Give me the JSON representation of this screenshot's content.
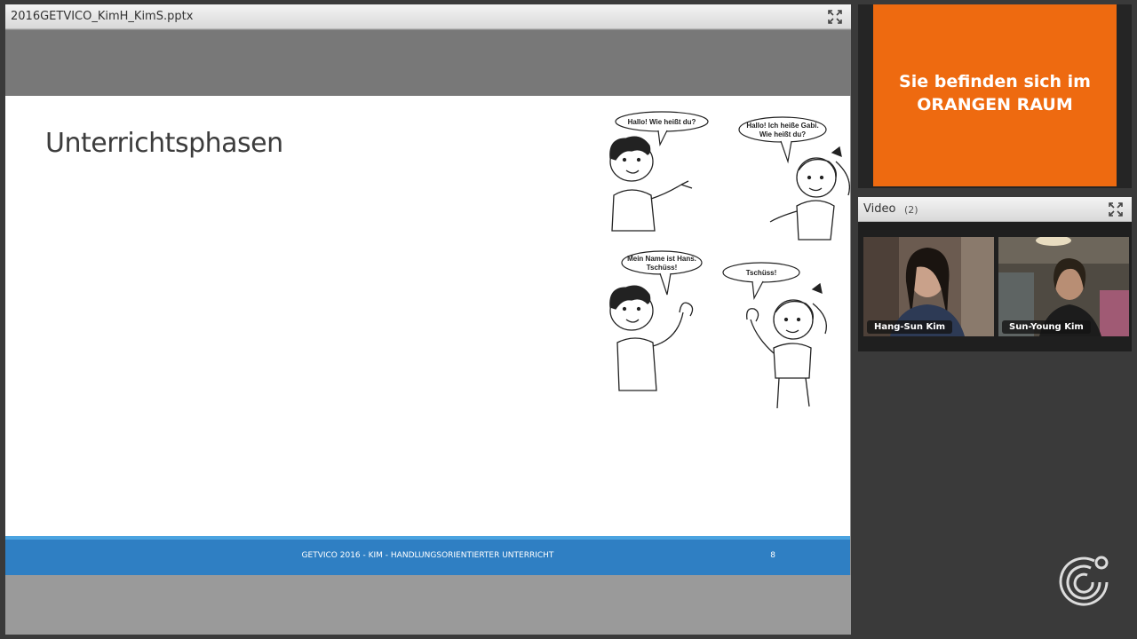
{
  "presentation": {
    "filename": "2016GETVICO_KimH_KimS.pptx",
    "slide": {
      "title": "Unterrichtsphasen",
      "footer": "GETVICO 2016 - KIM - HANDLUNGSORIENTIERTER UNTERRICHT",
      "page_number": "8",
      "speech_bubbles": {
        "boy_1": "Hallo! Wie heißt du?",
        "girl_1_line1": "Hallo! Ich heiße Gabi.",
        "girl_1_line2": "Wie heißt du?",
        "boy_2_line1": "Mein Name ist Hans.",
        "boy_2_line2": "Tschüss!",
        "girl_2": "Tschüss!"
      }
    }
  },
  "notice": {
    "line1": "Sie befinden sich im",
    "line2": "ORANGEN RAUM"
  },
  "video": {
    "title": "Video",
    "count": "(2)",
    "participants": [
      {
        "name": "Hang-Sun Kim"
      },
      {
        "name": "Sun-Young Kim"
      }
    ]
  },
  "icons": {
    "expand": "expand-icon",
    "logo": "goethe-institut-logo"
  },
  "colors": {
    "orange": "#ee6a10",
    "footer_blue": "#2f7fc3"
  }
}
